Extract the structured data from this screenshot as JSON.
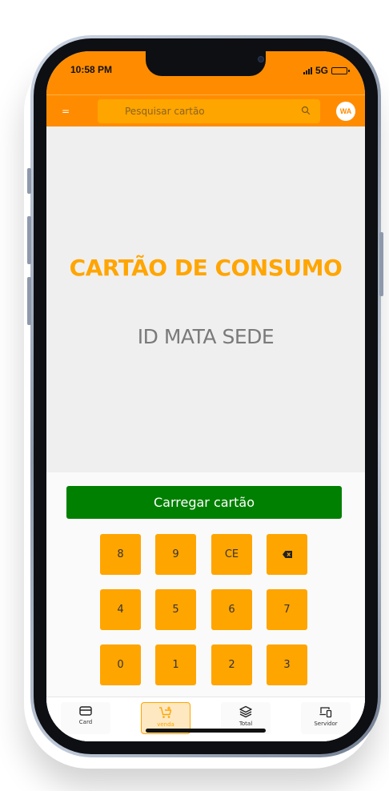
{
  "status_bar": {
    "time": "10:58 PM",
    "network": "5G"
  },
  "header": {
    "menu_icon": "=",
    "search_placeholder": "Pesquisar cartão",
    "avatar_initials": "WA"
  },
  "main": {
    "title": "CARTÃO DE CONSUMO",
    "subtitle": "ID MATA SEDE"
  },
  "panel": {
    "load_button_label": "Carregar cartão",
    "keypad": [
      [
        "8",
        "9",
        "CE",
        "backspace-icon"
      ],
      [
        "4",
        "5",
        "6",
        "7"
      ],
      [
        "0",
        "1",
        "2",
        "3"
      ]
    ]
  },
  "bottom_nav": {
    "items": [
      {
        "label": "Card",
        "icon": "card-icon",
        "active": false
      },
      {
        "label": "venda",
        "icon": "cart-add-icon",
        "active": true
      },
      {
        "label": "Total",
        "icon": "layers-icon",
        "active": false
      },
      {
        "label": "Servidor",
        "icon": "device-sync-icon",
        "active": false
      }
    ]
  },
  "colors": {
    "primary_orange": "#ff8c00",
    "key_orange": "#ffa500",
    "load_green": "#008000"
  }
}
